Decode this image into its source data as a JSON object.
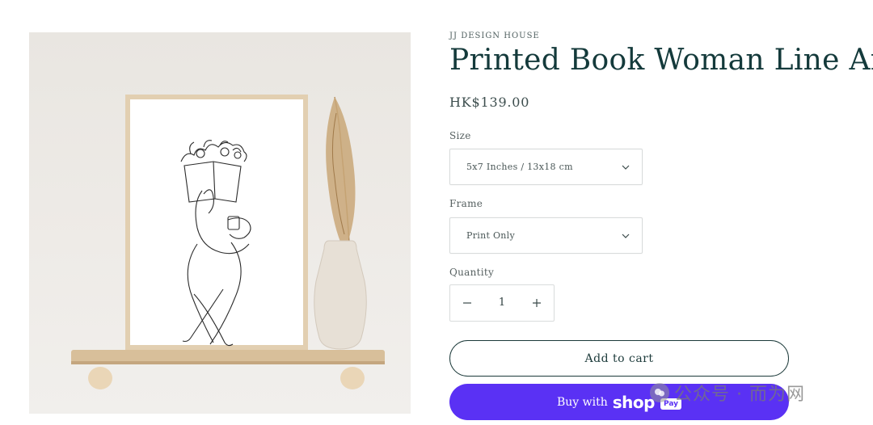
{
  "product": {
    "vendor": "JJ DESIGN HOUSE",
    "title": "Printed Book Woman Line Art",
    "price": "HK$139.00"
  },
  "options": {
    "size": {
      "label": "Size",
      "selected": "5x7 Inches / 13x18 cm"
    },
    "frame": {
      "label": "Frame",
      "selected": "Print Only"
    }
  },
  "quantity": {
    "label": "Quantity",
    "value": "1",
    "decrease_icon": "minus-icon",
    "increase_icon": "plus-icon"
  },
  "actions": {
    "add_to_cart": "Add to cart",
    "buy_with": "Buy with",
    "shop_word": "shop",
    "pay_badge": "Pay",
    "shop_pay_color": "#5a31f4"
  },
  "watermark": {
    "text": "公众号 · 而为网"
  },
  "colors": {
    "accent": "#1c3a3a",
    "image_background": "#ebe8e4"
  }
}
